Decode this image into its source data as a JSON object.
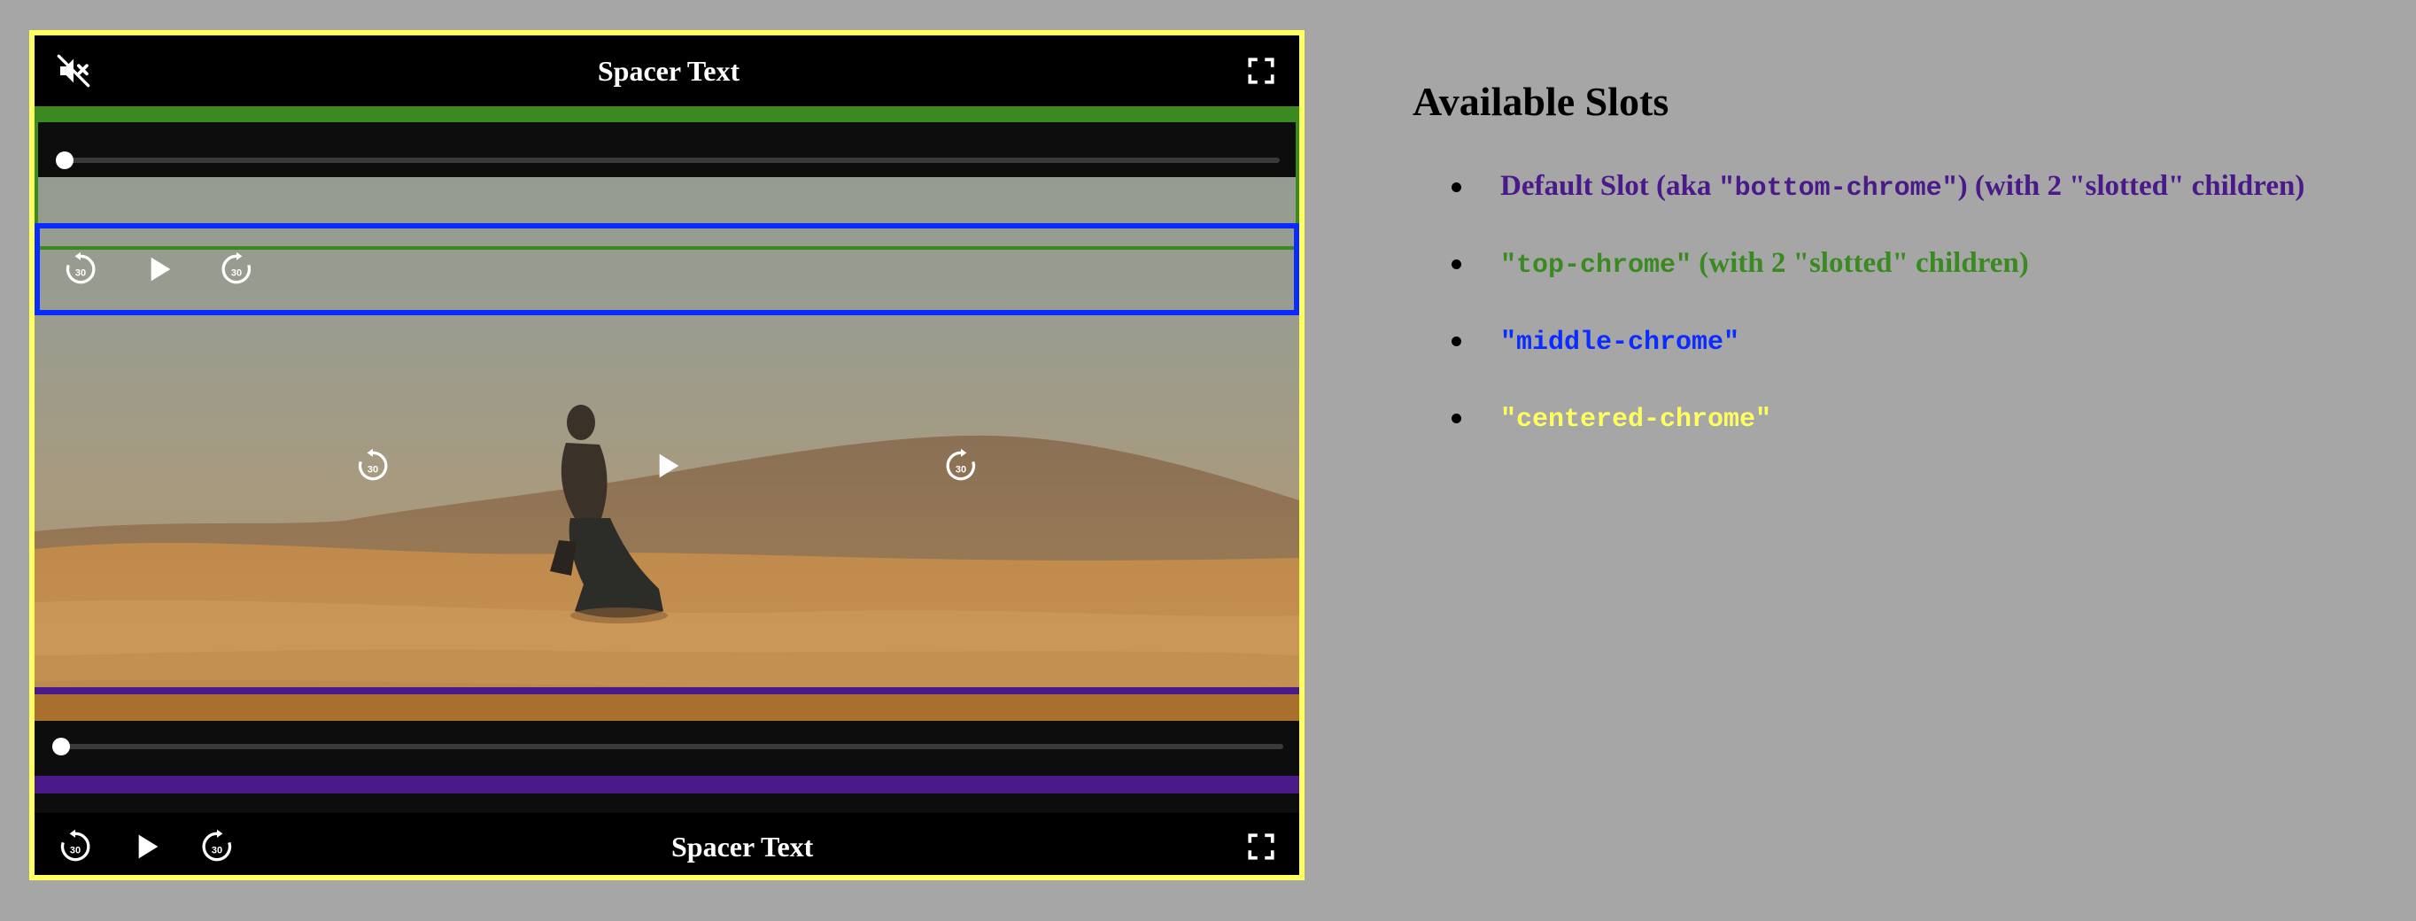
{
  "player": {
    "top_spacer_text": "Spacer Text",
    "bottom_spacer_text": "Spacer Text",
    "seek_icon_label": "30",
    "top_progress": 0,
    "bottom_progress": 0
  },
  "slots": {
    "title": "Available Slots",
    "items": [
      {
        "prefix": "Default Slot (aka ",
        "code": "\"bottom-chrome\"",
        "suffix": ") (with 2 \"slotted\" children)",
        "color": "#4a1a8a"
      },
      {
        "prefix": "",
        "code": "\"top-chrome\"",
        "suffix": " (with 2 \"slotted\" children)",
        "color": "#3a8a21"
      },
      {
        "prefix": "",
        "code": "\"middle-chrome\"",
        "suffix": "",
        "color": "#0a2cff"
      },
      {
        "prefix": "",
        "code": "\"centered-chrome\"",
        "suffix": "",
        "color": "#ffff60"
      }
    ]
  },
  "colors": {
    "background": "#a6a6a6",
    "centered_chrome": "#ffff60",
    "top_chrome": "#3a8a21",
    "middle_chrome": "#0a2cff",
    "bottom_chrome": "#4a1a8a"
  },
  "icons": [
    "mute-icon",
    "fullscreen-icon",
    "seek-backward-30-icon",
    "play-icon",
    "seek-forward-30-icon"
  ]
}
